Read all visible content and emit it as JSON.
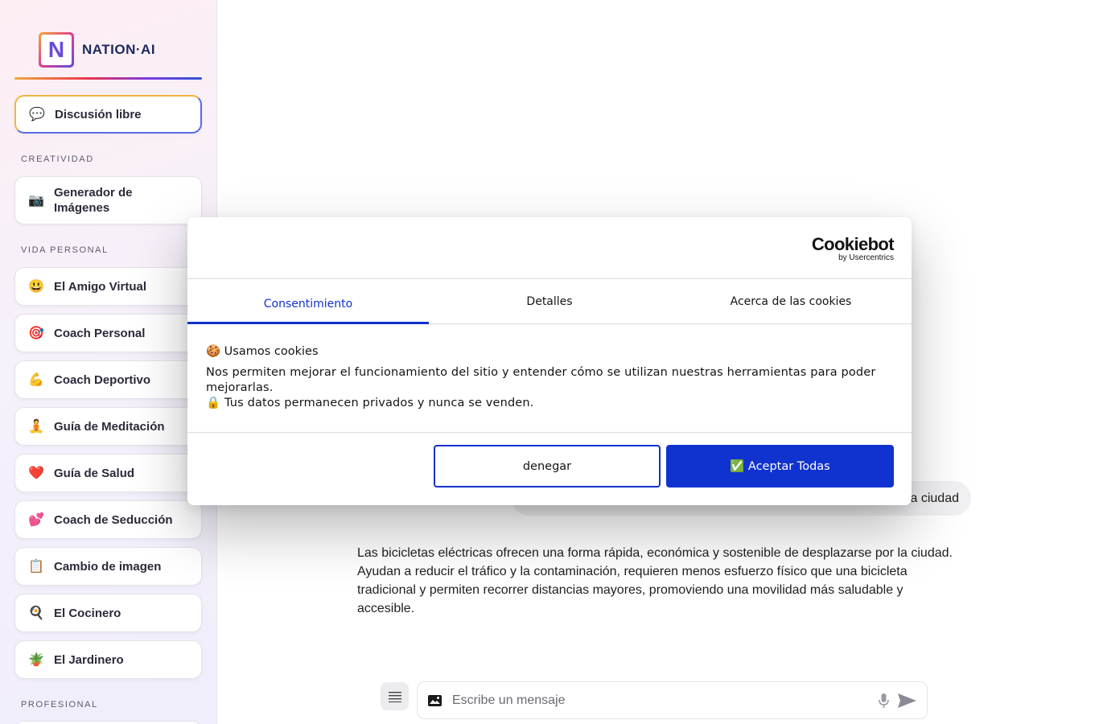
{
  "brand": {
    "logo_letter": "N",
    "name": "NATION·AI"
  },
  "sidebar": {
    "active_item": {
      "label": "Discusión libre",
      "emoji": "💬"
    },
    "sections": [
      {
        "label": "CREATIVIDAD"
      },
      {
        "label": "VIDA PERSONAL"
      },
      {
        "label": "PROFESIONAL"
      }
    ],
    "creativity_items": [
      {
        "label": "Generador de Imágenes",
        "emoji": "📷"
      }
    ],
    "personal_items": [
      {
        "label": "El Amigo Virtual",
        "emoji": "😃"
      },
      {
        "label": "Coach Personal",
        "emoji": "🎯"
      },
      {
        "label": "Coach Deportivo",
        "emoji": "💪"
      },
      {
        "label": "Guía de Meditación",
        "emoji": "🧘"
      },
      {
        "label": "Guía de Salud",
        "emoji": "❤️"
      },
      {
        "label": "Coach de Seducción",
        "emoji": "💕"
      },
      {
        "label": "Cambio de imagen",
        "emoji": "📋"
      },
      {
        "label": "El Cocinero",
        "emoji": "🍳"
      },
      {
        "label": "El Jardinero",
        "emoji": "🪴"
      }
    ]
  },
  "chat": {
    "user_message_visible": "a ciudad",
    "assistant_message": "Las bicicletas eléctricas ofrecen una forma rápida, económica y sostenible de desplazarse por la ciudad. Ayudan a reducir el tráfico y la contaminación, requieren menos esfuerzo físico que una bicicleta tradicional y permiten recorrer distancias mayores, promoviendo una movilidad más saludable y accesible.",
    "input_placeholder": "Escribe un mensaje"
  },
  "cookie_dialog": {
    "brand_name": "Cookiebot",
    "brand_sub": "by Usercentrics",
    "tabs": [
      "Consentimiento",
      "Detalles",
      "Acerca de las cookies"
    ],
    "active_tab": "Consentimiento",
    "title_emoji": "🍪",
    "title": "Usamos cookies",
    "description": "Nos permiten mejorar el funcionamiento del sitio y entender cómo se utilizan nuestras herramientas para poder mejorarlas.",
    "privacy_emoji": "🔒",
    "privacy_note": "Tus datos permanecen privados y nunca se venden.",
    "deny_label": "denegar",
    "accept_emoji": "✅",
    "accept_label": "Aceptar Todas"
  },
  "colors": {
    "primary_blue": "#1032cf",
    "gradient_orange": "#f2a93b",
    "gradient_pink": "#e0418e",
    "gradient_purple": "#5b4ce0"
  },
  "icons": {
    "tools": "hamburger-menu-icon",
    "image": "image-icon",
    "mic": "microphone-icon",
    "send": "send-icon"
  }
}
